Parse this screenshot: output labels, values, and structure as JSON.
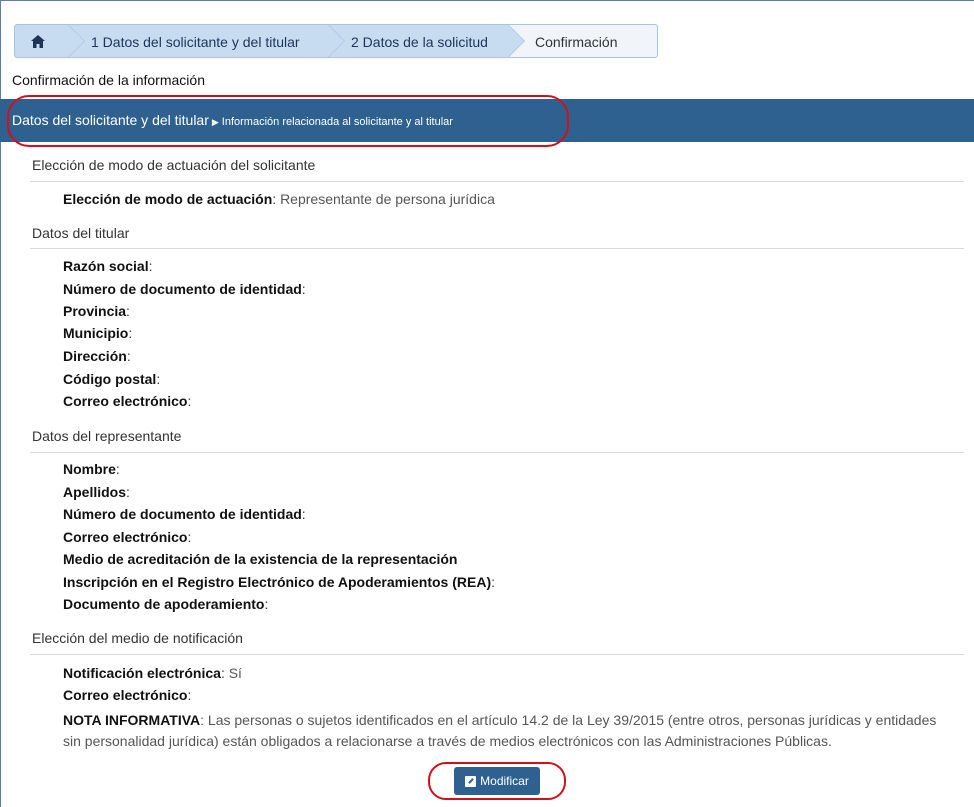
{
  "breadcrumb": {
    "home_icon": "home-icon",
    "step1": "1 Datos del solicitante y del titular",
    "step2": "2 Datos de la solicitud",
    "step3": "Confirmación"
  },
  "page_title": "Confirmación de la información",
  "section": {
    "title": "Datos del solicitante y del titular",
    "subtitle": "Información relacionada al solicitante y al titular"
  },
  "groups": {
    "mode": {
      "title": "Elección de modo de actuación del solicitante",
      "label": "Elección de modo de actuación",
      "value": "Representante de persona jurídica"
    },
    "holder": {
      "title": "Datos del titular",
      "fields": [
        "Razón social",
        "Número de documento de identidad",
        "Provincia",
        "Municipio",
        "Dirección",
        "Código postal",
        "Correo electrónico"
      ]
    },
    "representative": {
      "title": "Datos del representante",
      "fields": [
        "Nombre",
        "Apellidos",
        "Número de documento de identidad",
        "Correo electrónico",
        "Medio de acreditación de la existencia de la representación",
        "Inscripción en el Registro Electrónico de Apoderamientos (REA)",
        "Documento de apoderamiento"
      ]
    },
    "notification": {
      "title": "Elección del medio de notificación",
      "electronic_label": "Notificación electrónica",
      "electronic_value": "Sí",
      "email_label": "Correo electrónico",
      "note_label": "NOTA INFORMATIVA",
      "note_text": "Las personas o sujetos identificados en el artículo 14.2 de la Ley 39/2015 (entre otros, personas jurídicas y entidades sin personalidad jurídica) están obligados a relacionarse a través de medios electrónicos con las Administraciones Públicas."
    }
  },
  "modify_button": "Modificar",
  "colors": {
    "primary": "#2f6190",
    "crumb": "#c7dcf1",
    "highlight": "#d0101a"
  }
}
